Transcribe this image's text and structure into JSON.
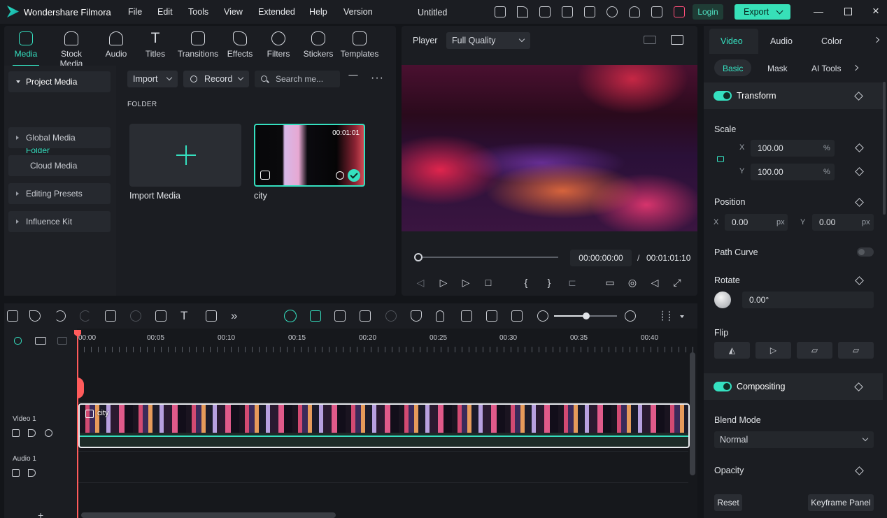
{
  "titlebar": {
    "app_name": "Wondershare Filmora",
    "menus": [
      "File",
      "Edit",
      "Tools",
      "View",
      "Extended",
      "Help",
      "Version"
    ],
    "doc_title": "Untitled",
    "login": "Login",
    "export": "Export"
  },
  "media": {
    "tabs": [
      "Media",
      "Stock Media",
      "Audio",
      "Titles",
      "Transitions",
      "Effects",
      "Filters",
      "Stickers",
      "Templates"
    ],
    "sidebar": [
      "Project Media",
      "Folder",
      "Global Media",
      "Cloud Media",
      "Editing Presets",
      "Influence Kit"
    ],
    "import_btn": "Import",
    "record_btn": "Record",
    "search_placeholder": "Search me...",
    "folder_label": "FOLDER",
    "import_tile": "Import Media",
    "clip_name": "city",
    "clip_duration": "00:01:01"
  },
  "player": {
    "label": "Player",
    "quality": "Full Quality",
    "current_time": "00:00:00:00",
    "separator": "/",
    "total_time": "00:01:01:10",
    "progress": 0.0
  },
  "props": {
    "tabs": [
      "Video",
      "Audio",
      "Color"
    ],
    "subtabs": [
      "Basic",
      "Mask",
      "AI Tools"
    ],
    "transform": "Transform",
    "scale": "Scale",
    "x": "X",
    "y": "Y",
    "scale_x": "100.00",
    "scale_y": "100.00",
    "percent": "%",
    "position": "Position",
    "pos_x": "0.00",
    "pos_y": "0.00",
    "px": "px",
    "path_curve": "Path Curve",
    "rotate": "Rotate",
    "rotate_val": "0.00°",
    "flip": "Flip",
    "compositing": "Compositing",
    "blend_mode": "Blend Mode",
    "blend_val": "Normal",
    "opacity": "Opacity",
    "reset": "Reset",
    "keyframe": "Keyframe Panel"
  },
  "timeline": {
    "ruler": [
      "00:00",
      "00:05",
      "00:10",
      "00:15",
      "00:20",
      "00:25",
      "00:30",
      "00:35",
      "00:40"
    ],
    "video_track": "Video 1",
    "audio_track": "Audio 1",
    "clip_label": "city"
  }
}
